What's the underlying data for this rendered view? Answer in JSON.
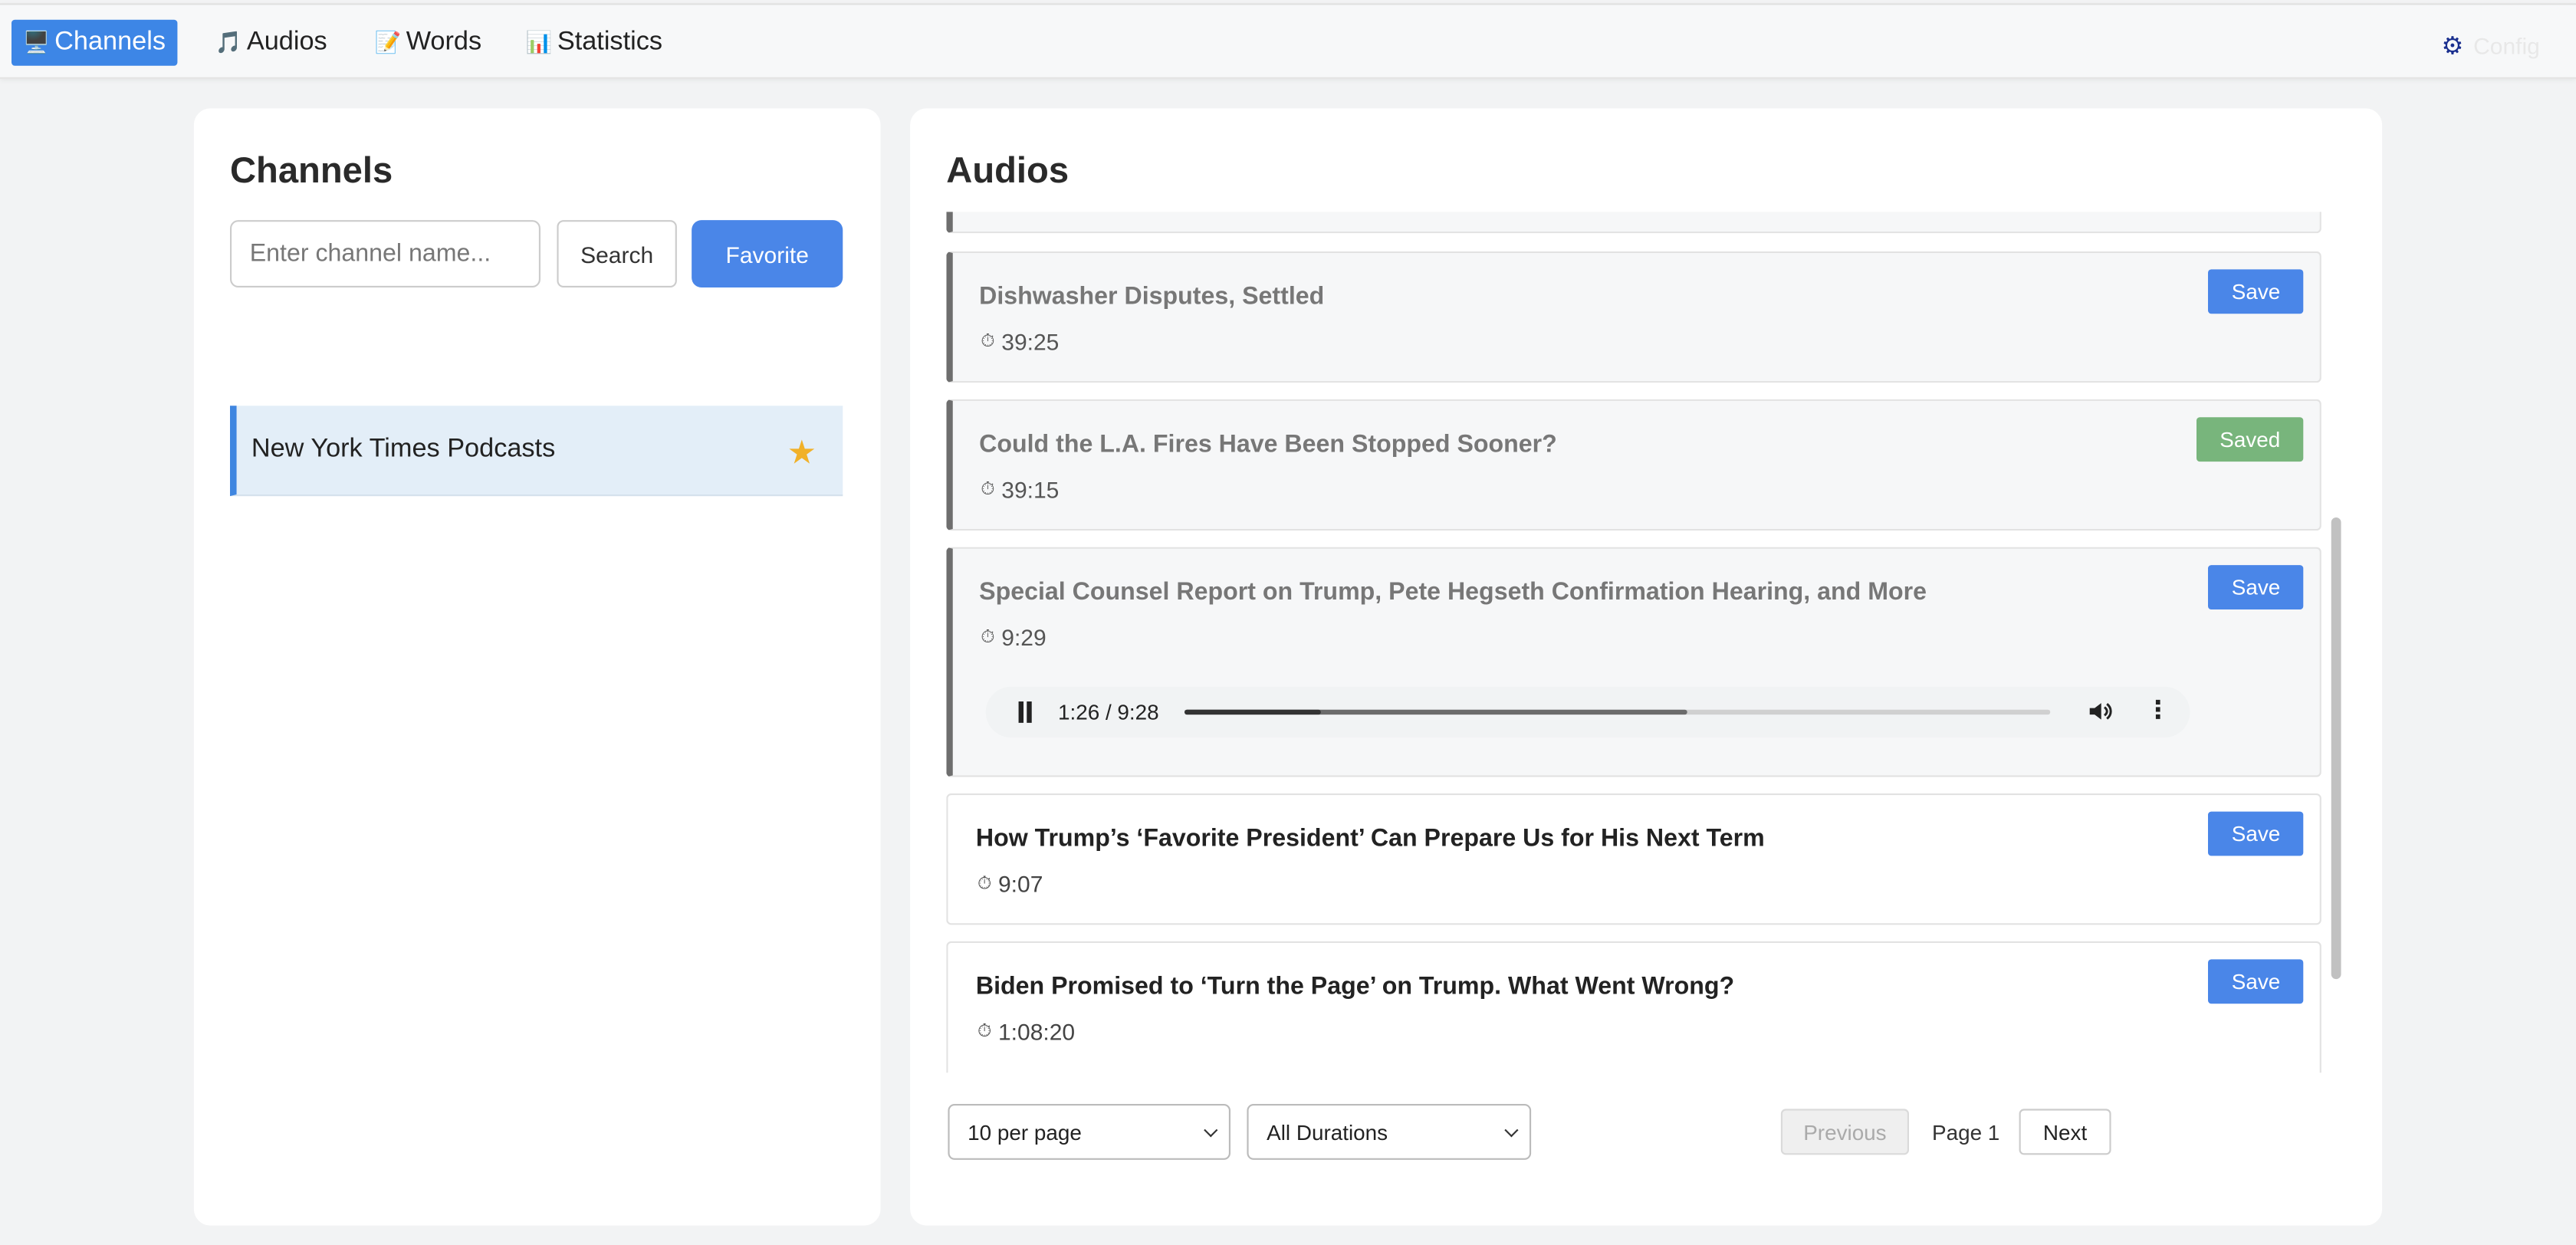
{
  "nav": {
    "items": [
      {
        "label": "Channels",
        "icon": "tv-icon",
        "active": true
      },
      {
        "label": "Audios",
        "icon": "music-note-icon",
        "active": false
      },
      {
        "label": "Words",
        "icon": "memo-icon",
        "active": false
      },
      {
        "label": "Statistics",
        "icon": "bar-chart-icon",
        "active": false
      }
    ],
    "config_label": "Config"
  },
  "channels": {
    "title": "Channels",
    "search_placeholder": "Enter channel name...",
    "search_label": "Search",
    "favorite_label": "Favorite",
    "list": [
      {
        "name": "New York Times Podcasts",
        "favorite": true
      }
    ]
  },
  "audios": {
    "title": "Audios",
    "items": [
      {
        "title": "Dishwasher Disputes, Settled",
        "duration": "39:25",
        "save_label": "Save",
        "saved": false
      },
      {
        "title": "Could the L.A. Fires Have Been Stopped Sooner?",
        "duration": "39:15",
        "save_label": "Saved",
        "saved": true
      },
      {
        "title": "Special Counsel Report on Trump, Pete Hegseth Confirmation Hearing, and More",
        "duration": "9:29",
        "save_label": "Save",
        "saved": false,
        "player": {
          "time": "1:26 / 9:28",
          "played_fraction": 0.158,
          "buffered_fraction": 0.58
        }
      },
      {
        "title": "How Trump’s ‘Favorite President’ Can Prepare Us for His Next Term",
        "duration": "9:07",
        "save_label": "Save",
        "saved": false
      },
      {
        "title": "Biden Promised to ‘Turn the Page’ on Trump. What Went Wrong?",
        "duration": "1:08:20",
        "save_label": "Save",
        "saved": false
      }
    ],
    "per_page": "10 per page",
    "duration_filter": "All Durations",
    "previous_label": "Previous",
    "page_label": "Page 1",
    "next_label": "Next"
  },
  "colors": {
    "accent": "#4a86e8",
    "saved": "#78b57c",
    "star": "#f1b129"
  }
}
